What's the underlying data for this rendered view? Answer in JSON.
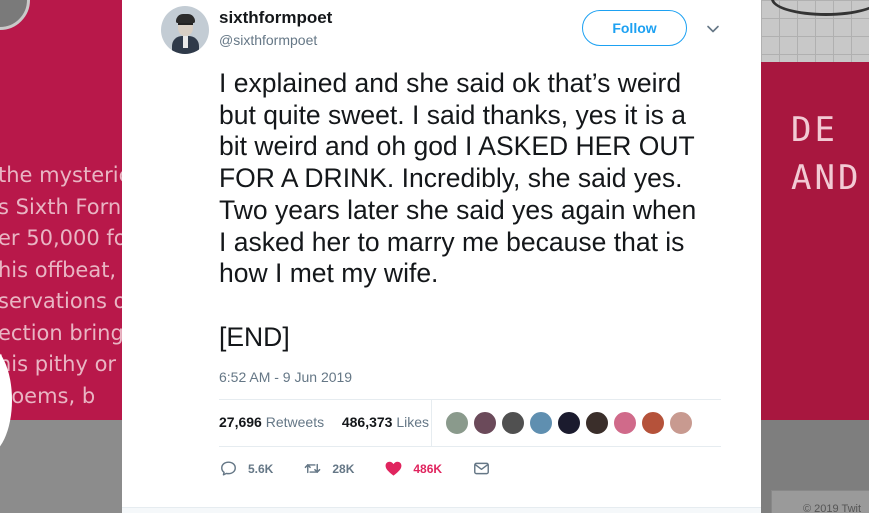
{
  "background": {
    "left_lines": [
      "the mysteric",
      "s Sixth Forn",
      "er 50,000 fol",
      "his offbeat,",
      "servations o",
      "ection brings",
      "his pithy or",
      "poems, b"
    ],
    "right_sign": [
      "DE",
      "AND"
    ],
    "footer_text": "© 2019 Twit"
  },
  "tweet": {
    "name": "sixthformpoet",
    "handle": "@sixthformpoet",
    "follow_label": "Follow",
    "text_lines": [
      "I explained and she said ok that’s weird",
      "but quite sweet. I said thanks, yes it is a",
      "bit weird and oh god I ASKED HER OUT",
      "FOR A DRINK. Incredibly, she said yes.",
      "Two years later she said yes again when",
      "I asked her to marry me because that is",
      "how I met my wife."
    ],
    "end_text": "[END]",
    "timestamp": "6:52 AM - 9 Jun 2019",
    "retweets_count": "27,696",
    "retweets_label": "Retweets",
    "likes_count": "486,373",
    "likes_label": "Likes",
    "liker_colors": [
      "#8a9a8c",
      "#6b4a5a",
      "#505050",
      "#5f8fb0",
      "#1b1b2e",
      "#3a2e2a",
      "#d06a8a",
      "#b5523a",
      "#c89a90"
    ],
    "actions": {
      "reply_count": "5.6K",
      "retweet_count": "28K",
      "like_count": "486K"
    },
    "colors": {
      "accent": "#1da1f2",
      "like": "#e0245e",
      "muted": "#657786",
      "text": "#14171a"
    }
  }
}
